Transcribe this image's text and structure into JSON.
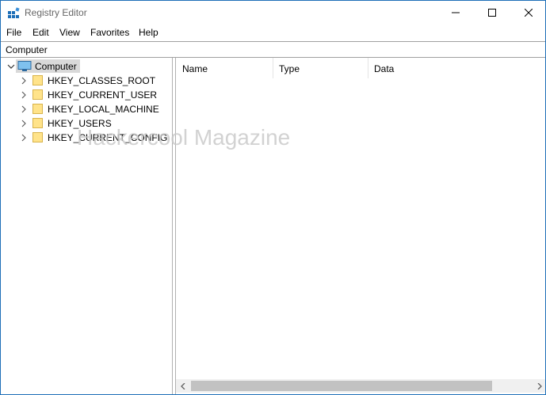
{
  "window": {
    "title": "Registry Editor"
  },
  "menu": [
    "File",
    "Edit",
    "View",
    "Favorites",
    "Help"
  ],
  "address": {
    "path": "Computer"
  },
  "tree": {
    "root": {
      "label": "Computer",
      "icon": "computer-icon",
      "expanded": true,
      "selected": true
    },
    "children": [
      {
        "label": "HKEY_CLASSES_ROOT",
        "icon": "folder-icon"
      },
      {
        "label": "HKEY_CURRENT_USER",
        "icon": "folder-icon"
      },
      {
        "label": "HKEY_LOCAL_MACHINE",
        "icon": "folder-icon"
      },
      {
        "label": "HKEY_USERS",
        "icon": "folder-icon"
      },
      {
        "label": "HKEY_CURRENT_CONFIG",
        "icon": "folder-icon"
      }
    ]
  },
  "list": {
    "columns": [
      "Name",
      "Type",
      "Data"
    ]
  },
  "watermark": "Hackercool Magazine",
  "colors": {
    "accent": "#1e6fb8",
    "selection": "#d9d9d9",
    "folder": "#ffe38a"
  }
}
